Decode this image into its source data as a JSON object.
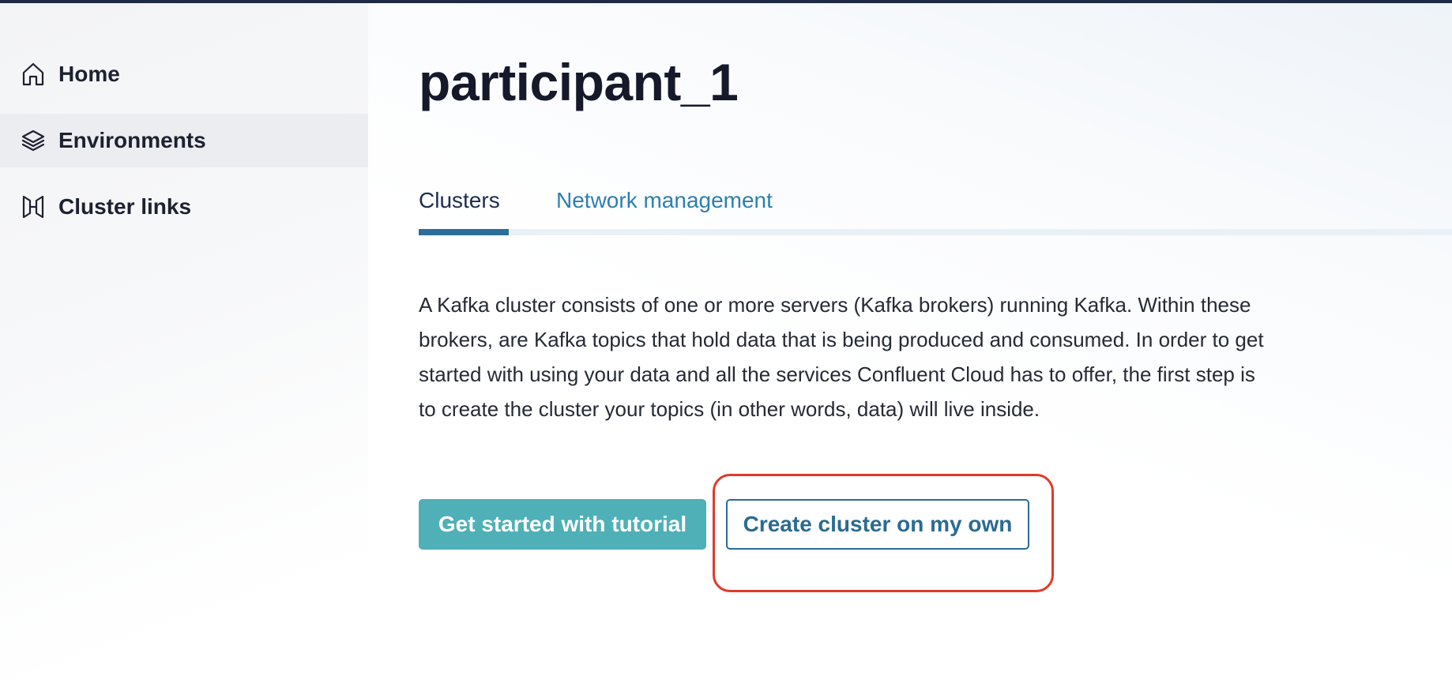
{
  "sidebar": {
    "items": [
      {
        "label": "Home",
        "icon": "home-icon"
      },
      {
        "label": "Environments",
        "icon": "layers-icon",
        "active": true
      },
      {
        "label": "Cluster links",
        "icon": "cluster-link-icon"
      }
    ]
  },
  "main": {
    "title": "participant_1",
    "tabs": [
      {
        "label": "Clusters",
        "selected": true
      },
      {
        "label": "Network management",
        "selected": false
      }
    ],
    "description": "A Kafka cluster consists of one or more servers (Kafka brokers) running Kafka. Within these brokers, are Kafka topics that hold data that is being produced and consumed. In order to get started with using your data and all the services Confluent Cloud has to offer, the first step is to create the cluster your topics (in other words, data) will live inside.",
    "buttons": {
      "tutorial": "Get started with tutorial",
      "create_own": "Create cluster on my own"
    }
  },
  "colors": {
    "primary_button": "#4fb0b8",
    "secondary_button_border": "#2a6b93",
    "tab_indicator": "#2b6f98",
    "link_tab": "#2d7fb0",
    "highlight": "#e03a2a",
    "top_bar": "#1f2a44"
  }
}
